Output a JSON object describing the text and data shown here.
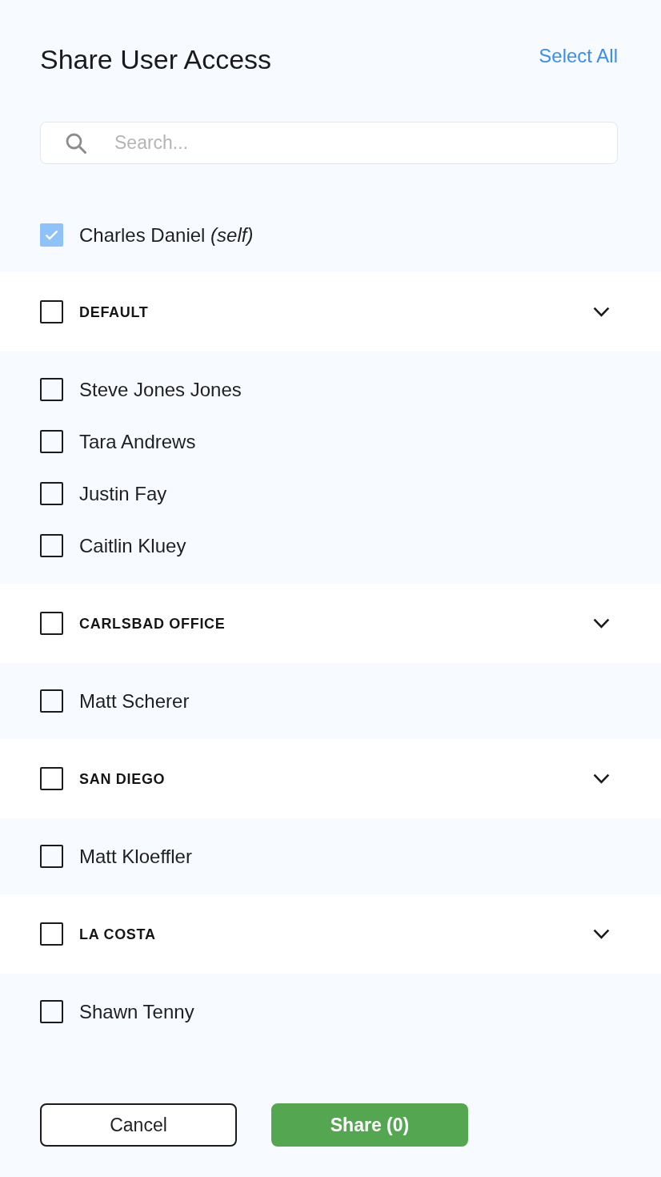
{
  "title": "Share User Access",
  "select_all": "Select All",
  "search": {
    "placeholder": "Search..."
  },
  "self_user": {
    "label": "Charles Daniel *(self)*",
    "checked": true,
    "disabled": true
  },
  "groups": [
    {
      "name": "DEFAULT",
      "checked": false,
      "expanded": true,
      "members": [
        {
          "name": "Steve Jones Jones",
          "checked": false
        },
        {
          "name": "Tara Andrews",
          "checked": false
        },
        {
          "name": "Justin Fay",
          "checked": false
        },
        {
          "name": "Caitlin Kluey",
          "checked": false
        }
      ]
    },
    {
      "name": "CARLSBAD OFFICE",
      "checked": false,
      "expanded": true,
      "members": [
        {
          "name": "Matt Scherer",
          "checked": false
        }
      ]
    },
    {
      "name": "SAN DIEGO",
      "checked": false,
      "expanded": true,
      "members": [
        {
          "name": "Matt Kloeffler",
          "checked": false
        }
      ]
    },
    {
      "name": "LA COSTA",
      "checked": false,
      "expanded": true,
      "members": [
        {
          "name": "Shawn Tenny",
          "checked": false
        }
      ]
    }
  ],
  "buttons": [
    {
      "label": "Cancel",
      "kind": "secondary"
    },
    {
      "label": "Share (0)",
      "kind": "primary"
    }
  ]
}
